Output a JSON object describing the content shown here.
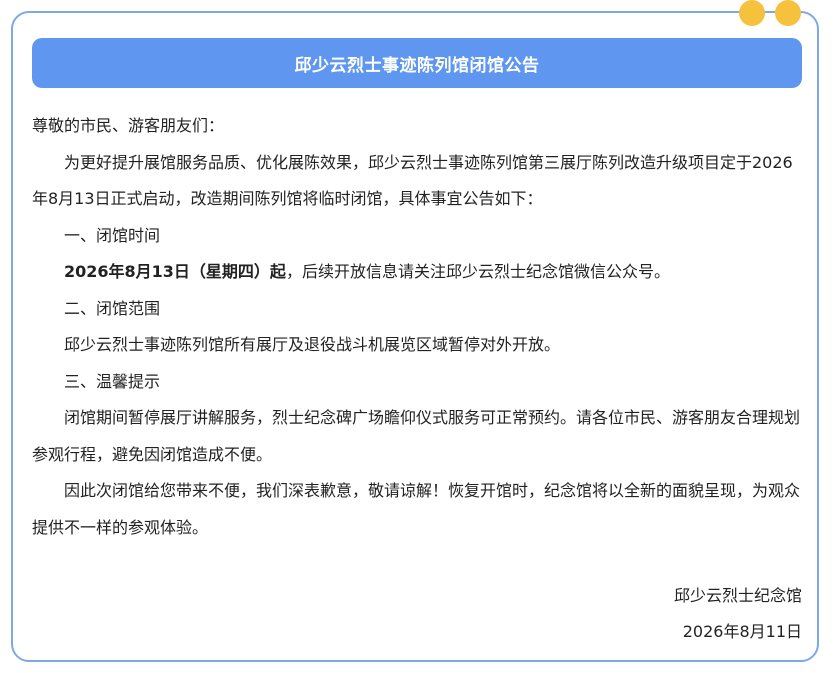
{
  "notice": {
    "title": "邱少云烈士事迹陈列馆闭馆公告",
    "salutation": "尊敬的市民、游客朋友们：",
    "intro": "为更好提升展馆服务品质、优化展陈效果，邱少云烈士事迹陈列馆第三展厅陈列改造升级项目定于2026年8月13日正式启动，改造期间陈列馆将临时闭馆，具体事宜公告如下：",
    "section1_heading": "一、闭馆时间",
    "section1_bold": "2026年8月13日（星期四）起",
    "section1_rest": "，后续开放信息请关注邱少云烈士纪念馆微信公众号。",
    "section2_heading": "二、闭馆范围",
    "section2_body": "邱少云烈士事迹陈列馆所有展厅及退役战斗机展览区域暂停对外开放。",
    "section3_heading": "三、温馨提示",
    "section3_body": "闭馆期间暂停展厅讲解服务，烈士纪念碑广场瞻仰仪式服务可正常预约。请各位市民、游客朋友合理规划参观行程，避免因闭馆造成不便。",
    "closing": "因此次闭馆给您带来不便，我们深表歉意，敬请谅解！恢复开馆时，纪念馆将以全新的面貌呈现，为观众提供不一样的参观体验。",
    "signature_org": "邱少云烈士纪念馆",
    "signature_date": "2026年8月11日"
  },
  "colors": {
    "title_bar": "#5f97f0",
    "border": "#7fa8ea",
    "dots": "#f6c23e"
  }
}
